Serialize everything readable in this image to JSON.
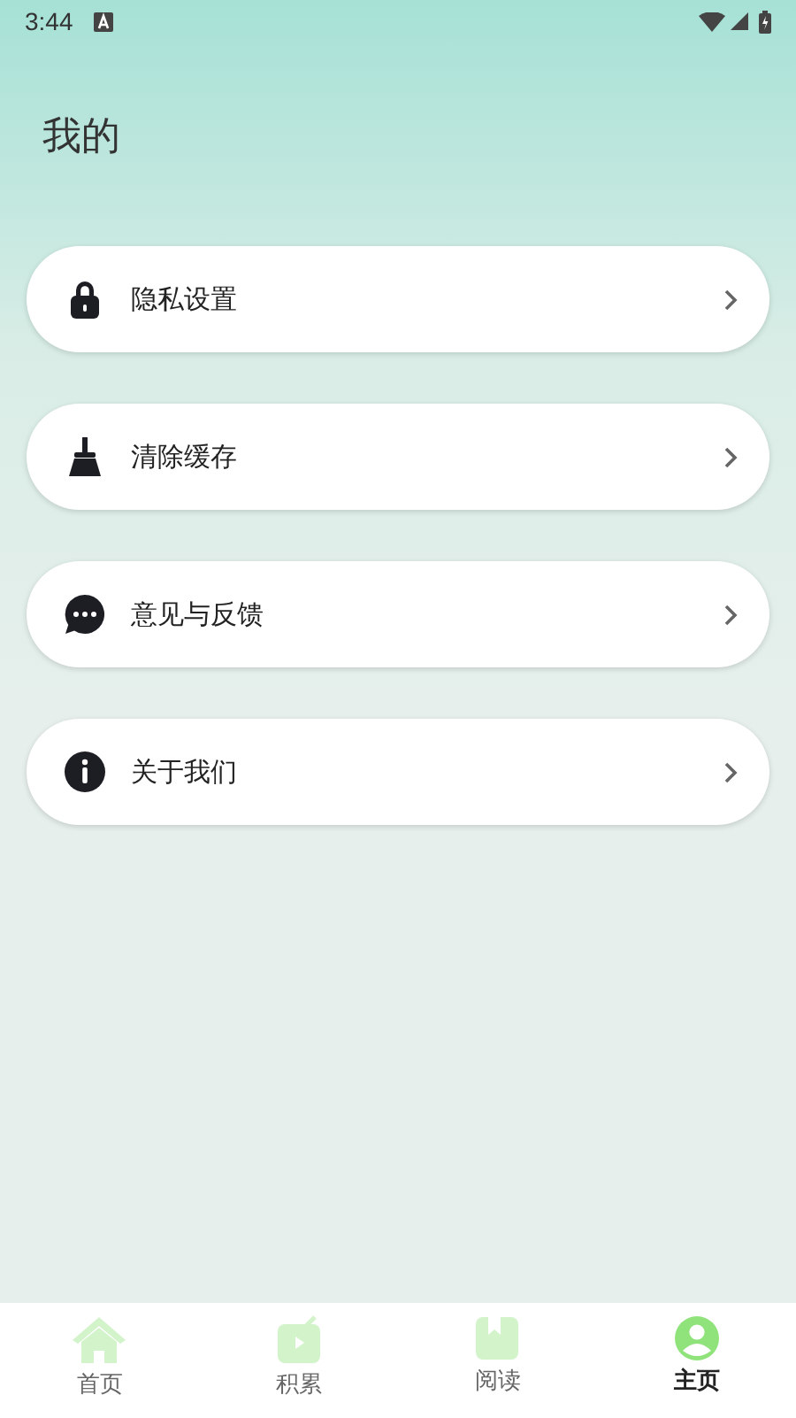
{
  "status_bar": {
    "time": "3:44"
  },
  "title": "我的",
  "menu": [
    {
      "kind": "lock",
      "label": "隐私设置"
    },
    {
      "kind": "broom",
      "label": "清除缓存"
    },
    {
      "kind": "chat",
      "label": "意见与反馈"
    },
    {
      "kind": "info",
      "label": "关于我们"
    }
  ],
  "tabs": [
    {
      "kind": "home",
      "label": "首页",
      "selected": false
    },
    {
      "kind": "tv",
      "label": "积累",
      "selected": false
    },
    {
      "kind": "book",
      "label": "阅读",
      "selected": false
    },
    {
      "kind": "person",
      "label": "主页",
      "selected": true
    }
  ]
}
